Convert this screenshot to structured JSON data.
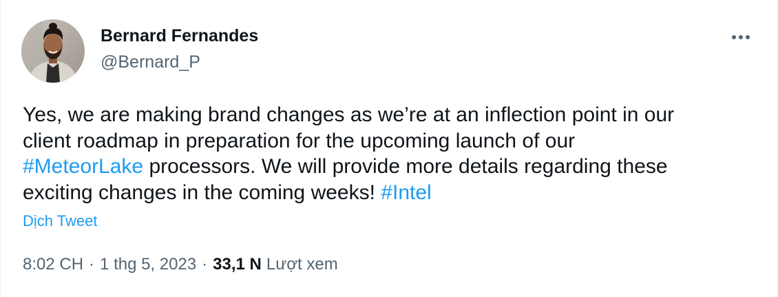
{
  "author": {
    "name": "Bernard Fernandes",
    "handle": "@Bernard_P"
  },
  "tweet": {
    "lines": [
      [
        {
          "type": "text",
          "value": "Yes, we are making brand changes as we’re at an inflection point in our"
        }
      ],
      [
        {
          "type": "text",
          "value": "client roadmap in preparation for the upcoming launch of our"
        }
      ],
      [
        {
          "type": "hashtag",
          "value": "#MeteorLake"
        },
        {
          "type": "text",
          "value": " processors. We will provide more details regarding these"
        }
      ],
      [
        {
          "type": "text",
          "value": "exciting changes in the coming weeks! "
        },
        {
          "type": "hashtag",
          "value": "#Intel"
        }
      ]
    ],
    "translate_label": "Dịch Tweet"
  },
  "meta": {
    "time": "8:02 CH",
    "separator": "·",
    "date": "1 thg 5, 2023",
    "views_count": "33,1 N",
    "views_label": "Lượt xem"
  },
  "icons": {
    "more": "more-horizontal-icon",
    "avatar": "user-avatar"
  },
  "colors": {
    "link": "#1d9bf0",
    "text_primary": "#0f1419",
    "text_secondary": "#536471"
  }
}
